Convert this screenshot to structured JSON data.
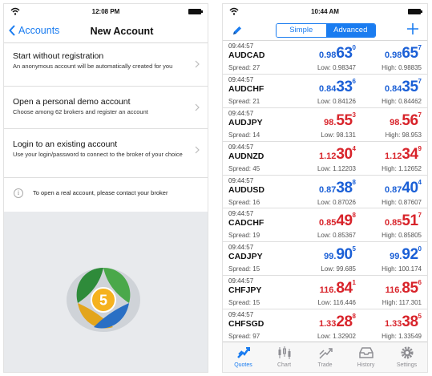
{
  "left": {
    "status_time": "12:08 PM",
    "back_label": "Accounts",
    "title": "New Account",
    "options": [
      {
        "title": "Start without registration",
        "subtitle": "An anonymous account will be automatically created for you"
      },
      {
        "title": "Open a personal demo account",
        "subtitle": "Choose among 62 brokers and register an account"
      },
      {
        "title": "Login to an existing account",
        "subtitle": "Use your login/password to connect to the broker of your choice"
      }
    ],
    "info_text": "To open a real account, please contact your broker",
    "logo_number": "5"
  },
  "right": {
    "status_time": "10:44 AM",
    "segment": {
      "simple": "Simple",
      "advanced": "Advanced",
      "selected": "Advanced"
    },
    "colors": {
      "accent": "#1a7cf0",
      "up": "#1a5fd6",
      "down": "#d8232a"
    },
    "quotes": [
      {
        "time": "09:44:57",
        "symbol": "AUDCAD",
        "spread": "Spread: 27",
        "dir": "up",
        "bid": {
          "small": "0.98",
          "big": "63",
          "sup": "0"
        },
        "ask": {
          "small": "0.98",
          "big": "65",
          "sup": "7"
        },
        "low": "Low: 0.98347",
        "high": "High: 0.98835"
      },
      {
        "time": "09:44:57",
        "symbol": "AUDCHF",
        "spread": "Spread: 21",
        "dir": "up",
        "bid": {
          "small": "0.84",
          "big": "33",
          "sup": "6"
        },
        "ask": {
          "small": "0.84",
          "big": "35",
          "sup": "7"
        },
        "low": "Low: 0.84126",
        "high": "High: 0.84462"
      },
      {
        "time": "09:44:57",
        "symbol": "AUDJPY",
        "spread": "Spread: 14",
        "dir": "down",
        "bid": {
          "small": "98.",
          "big": "55",
          "sup": "3"
        },
        "ask": {
          "small": "98.",
          "big": "56",
          "sup": "7"
        },
        "low": "Low: 98.131",
        "high": "High: 98.953"
      },
      {
        "time": "09:44:57",
        "symbol": "AUDNZD",
        "spread": "Spread: 45",
        "dir": "down",
        "bid": {
          "small": "1.12",
          "big": "30",
          "sup": "4"
        },
        "ask": {
          "small": "1.12",
          "big": "34",
          "sup": "9"
        },
        "low": "Low: 1.12203",
        "high": "High: 1.12652"
      },
      {
        "time": "09:44:57",
        "symbol": "AUDUSD",
        "spread": "Spread: 16",
        "dir": "up",
        "bid": {
          "small": "0.87",
          "big": "38",
          "sup": "8"
        },
        "ask": {
          "small": "0.87",
          "big": "40",
          "sup": "4"
        },
        "low": "Low: 0.87026",
        "high": "High: 0.87607"
      },
      {
        "time": "09:44:57",
        "symbol": "CADCHF",
        "spread": "Spread: 19",
        "dir": "down",
        "bid": {
          "small": "0.85",
          "big": "49",
          "sup": "8"
        },
        "ask": {
          "small": "0.85",
          "big": "51",
          "sup": "7"
        },
        "low": "Low: 0.85367",
        "high": "High: 0.85805"
      },
      {
        "time": "09:44:57",
        "symbol": "CADJPY",
        "spread": "Spread: 15",
        "dir": "up",
        "bid": {
          "small": "99.",
          "big": "90",
          "sup": "5"
        },
        "ask": {
          "small": "99.",
          "big": "92",
          "sup": "0"
        },
        "low": "Low: 99.685",
        "high": "High: 100.174"
      },
      {
        "time": "09:44:57",
        "symbol": "CHFJPY",
        "spread": "Spread: 15",
        "dir": "down",
        "bid": {
          "small": "116.",
          "big": "84",
          "sup": "1"
        },
        "ask": {
          "small": "116.",
          "big": "85",
          "sup": "6"
        },
        "low": "Low: 116.446",
        "high": "High: 117.301"
      },
      {
        "time": "09:44:57",
        "symbol": "CHFSGD",
        "spread": "Spread: 97",
        "dir": "down",
        "bid": {
          "small": "1.33",
          "big": "28",
          "sup": "8"
        },
        "ask": {
          "small": "1.33",
          "big": "38",
          "sup": "5"
        },
        "low": "Low: 1.32902",
        "high": "High: 1.33549"
      }
    ],
    "tabs": [
      {
        "label": "Quotes",
        "icon": "quotes-icon",
        "active": true
      },
      {
        "label": "Chart",
        "icon": "chart-icon",
        "active": false
      },
      {
        "label": "Trade",
        "icon": "trade-icon",
        "active": false
      },
      {
        "label": "History",
        "icon": "history-icon",
        "active": false
      },
      {
        "label": "Settings",
        "icon": "settings-icon",
        "active": false
      }
    ]
  }
}
